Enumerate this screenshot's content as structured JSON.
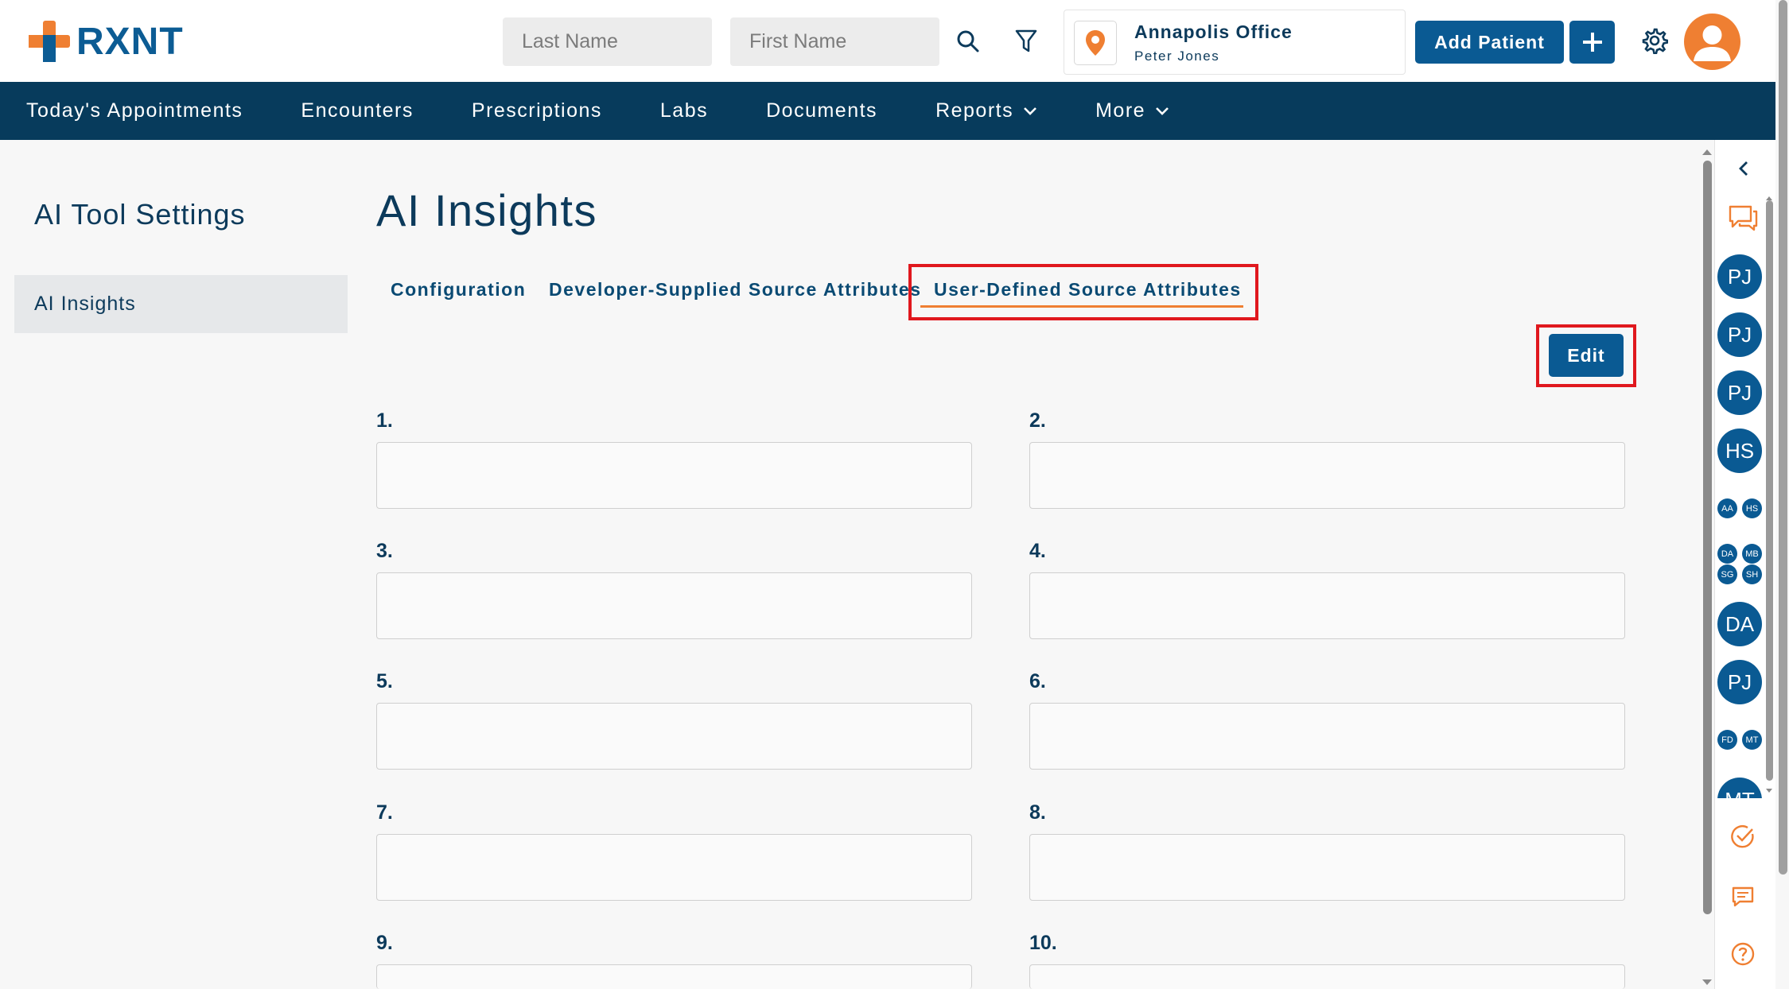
{
  "app": {
    "logo_text": "RXNT",
    "colors": {
      "brand_blue": "#0a5a93",
      "nav_bg": "#073b5c",
      "accent_orange": "#ef7f32",
      "highlight_red": "#e0181e"
    }
  },
  "header": {
    "last_name_placeholder": "Last Name",
    "first_name_placeholder": "First Name",
    "search_icon": "search-icon",
    "filter_icon": "filter-icon",
    "office": {
      "name": "Annapolis Office",
      "user": "Peter Jones"
    },
    "add_patient_label": "Add Patient",
    "plus_label": "+",
    "settings_icon": "gear-icon"
  },
  "nav": {
    "items": [
      {
        "label": "Today's Appointments"
      },
      {
        "label": "Encounters"
      },
      {
        "label": "Prescriptions"
      },
      {
        "label": "Labs"
      },
      {
        "label": "Documents"
      },
      {
        "label": "Reports"
      },
      {
        "label": "More"
      }
    ]
  },
  "sidebar": {
    "title": "AI Tool Settings",
    "items": [
      {
        "label": "AI Insights"
      }
    ]
  },
  "main": {
    "title": "AI Insights",
    "tabs": [
      {
        "label": "Configuration"
      },
      {
        "label": "Developer-Supplied Source Attributes"
      },
      {
        "label": "User-Defined Source Attributes",
        "active": true
      }
    ],
    "edit_label": "Edit",
    "fields": [
      {
        "label": "1.",
        "value": ""
      },
      {
        "label": "2.",
        "value": ""
      },
      {
        "label": "3.",
        "value": ""
      },
      {
        "label": "4.",
        "value": ""
      },
      {
        "label": "5.",
        "value": ""
      },
      {
        "label": "6.",
        "value": ""
      },
      {
        "label": "7.",
        "value": ""
      },
      {
        "label": "8.",
        "value": ""
      },
      {
        "label": "9.",
        "value": ""
      },
      {
        "label": "10.",
        "value": ""
      }
    ]
  },
  "right_rail": {
    "chips_big": [
      "PJ",
      "PJ",
      "PJ",
      "HS"
    ],
    "chips_small_row1": [
      "AA",
      "HS"
    ],
    "chips_small_grid": [
      "DA",
      "MB",
      "SG",
      "SH"
    ],
    "chips_big_2": [
      "DA",
      "PJ"
    ],
    "chips_small_row2": [
      "FD",
      "MT"
    ],
    "chip_cut": "MT"
  }
}
